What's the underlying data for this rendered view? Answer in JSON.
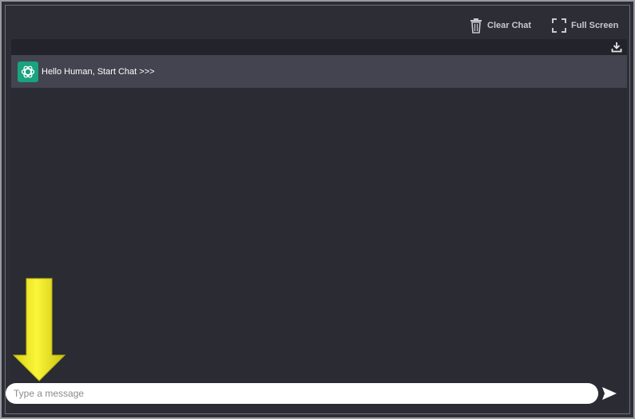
{
  "toolbar": {
    "clear_chat_label": "Clear Chat",
    "clear_chat_icon": "trash-icon",
    "full_screen_label": "Full Screen",
    "full_screen_icon": "fullscreen-icon"
  },
  "panel": {
    "download_icon": "download-icon"
  },
  "messages": [
    {
      "sender": "bot",
      "avatar_icon": "openai-logo-icon",
      "text": "Hello Human, Start Chat >>>"
    }
  ],
  "composer": {
    "placeholder": "Type a message",
    "value": "",
    "send_icon": "send-icon"
  },
  "annotation": {
    "arrow_icon": "down-arrow-icon",
    "arrow_color": "#f5ef1e"
  },
  "colors": {
    "background": "#2c2d35",
    "message_row": "#43444f",
    "avatar_bg": "#19a37f"
  }
}
